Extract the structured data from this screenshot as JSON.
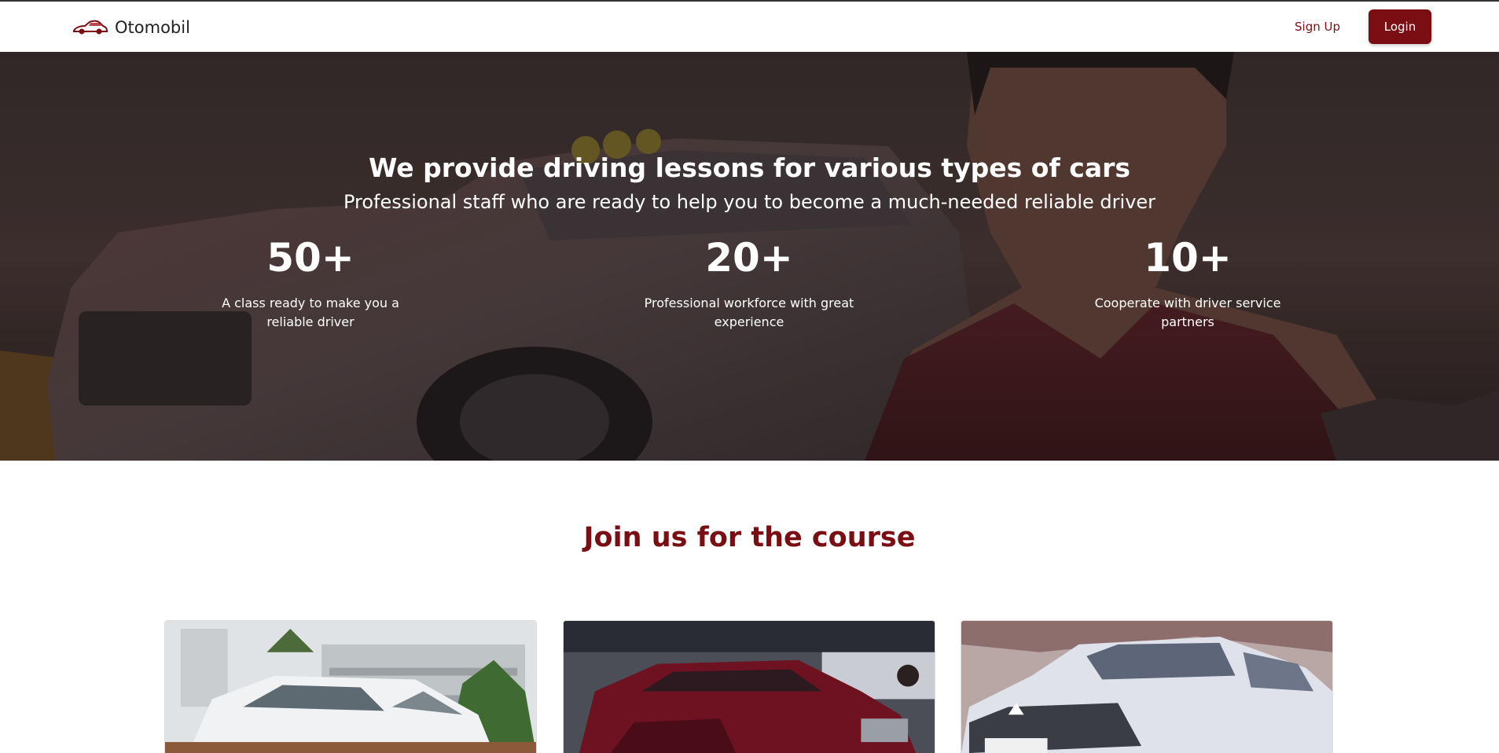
{
  "navbar": {
    "brand_name": "Otomobil",
    "brand_icon": "car-icon",
    "signup_label": "Sign Up",
    "login_label": "Login"
  },
  "hero": {
    "title": "We provide driving lessons for various types of cars",
    "subtitle": "Professional staff who are ready to help you to become a much-needed reliable driver",
    "stats": [
      {
        "value": "50+",
        "description": "A class ready to make you a reliable driver"
      },
      {
        "value": "20+",
        "description": "Professional workforce with great experience"
      },
      {
        "value": "10+",
        "description": "Cooperate with driver service partners"
      }
    ]
  },
  "course_section": {
    "title": "Join us for the course",
    "cards": [
      {
        "image": "white-minivan-photo"
      },
      {
        "image": "red-suv-photo"
      },
      {
        "image": "silver-suv-photo"
      }
    ]
  },
  "colors": {
    "brand": "#7a0e12",
    "text_dark": "#222222",
    "white": "#ffffff"
  }
}
